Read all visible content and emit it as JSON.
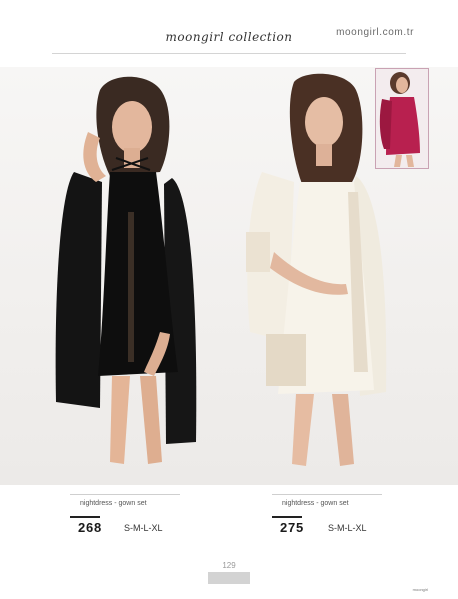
{
  "header": {
    "site_url": "moongirl.com.tr",
    "collection_title": "moongirl collection"
  },
  "products": [
    {
      "subtitle": "nightdress - gown set",
      "code": "268",
      "sizes": "S-M-L-XL",
      "color": "#1a1a1a"
    },
    {
      "subtitle": "nightdress - gown set",
      "code": "275",
      "sizes": "S-M-L-XL",
      "color": "#f4f0e6"
    }
  ],
  "inset_color": "#b8204f",
  "footer": {
    "page_number": "129",
    "mark": "moongirl"
  }
}
